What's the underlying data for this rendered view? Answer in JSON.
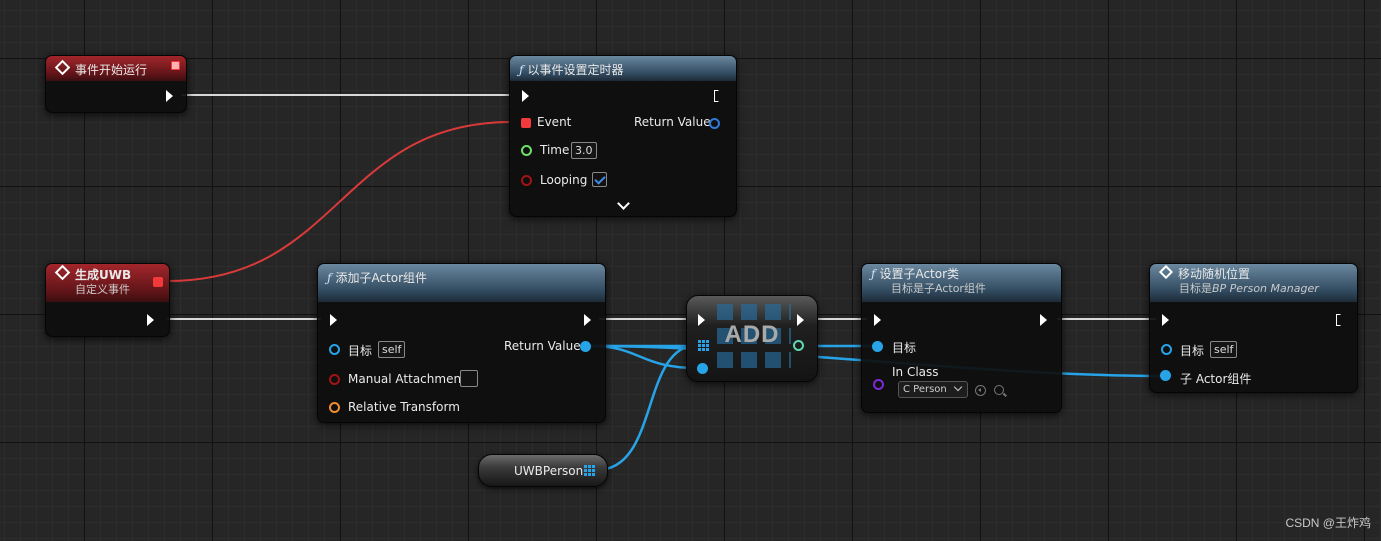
{
  "colors": {
    "exec": "#ffffff",
    "event_delegate": "#f33a3a",
    "object": "#27a4e8",
    "float": "#6fe067",
    "bool": "#a01414",
    "transform": "#f28c30",
    "class": "#7b2bd6"
  },
  "nodes": {
    "begin_play": {
      "title": "事件开始运行"
    },
    "set_timer": {
      "title": "以事件设置定时器",
      "pins": {
        "event": "Event",
        "time": "Time",
        "time_value": "3.0",
        "looping": "Looping",
        "return_value": "Return Value"
      }
    },
    "custom_event": {
      "title": "生成UWB",
      "subtitle": "自定义事件"
    },
    "add_child_actor": {
      "title": "添加子Actor组件",
      "pins": {
        "target": "目标",
        "target_value": "self",
        "manual_attachment": "Manual Attachment",
        "relative_transform": "Relative Transform",
        "return_value": "Return Value"
      }
    },
    "add_array": {
      "label": "ADD"
    },
    "uwb_person": {
      "label": "UWBPerson"
    },
    "set_child_actor_class": {
      "title": "设置子Actor类",
      "subtitle": "目标是子Actor组件",
      "pins": {
        "target": "目标",
        "in_class": "In Class",
        "in_class_value": "C Person"
      }
    },
    "move_random": {
      "title": "移动随机位置",
      "subtitle_prefix": "目标是",
      "subtitle_target": "BP Person Manager",
      "pins": {
        "target": "目标",
        "target_value": "self",
        "child_actor": "子 Actor组件"
      }
    }
  },
  "watermark": "CSDN @王炸鸡"
}
